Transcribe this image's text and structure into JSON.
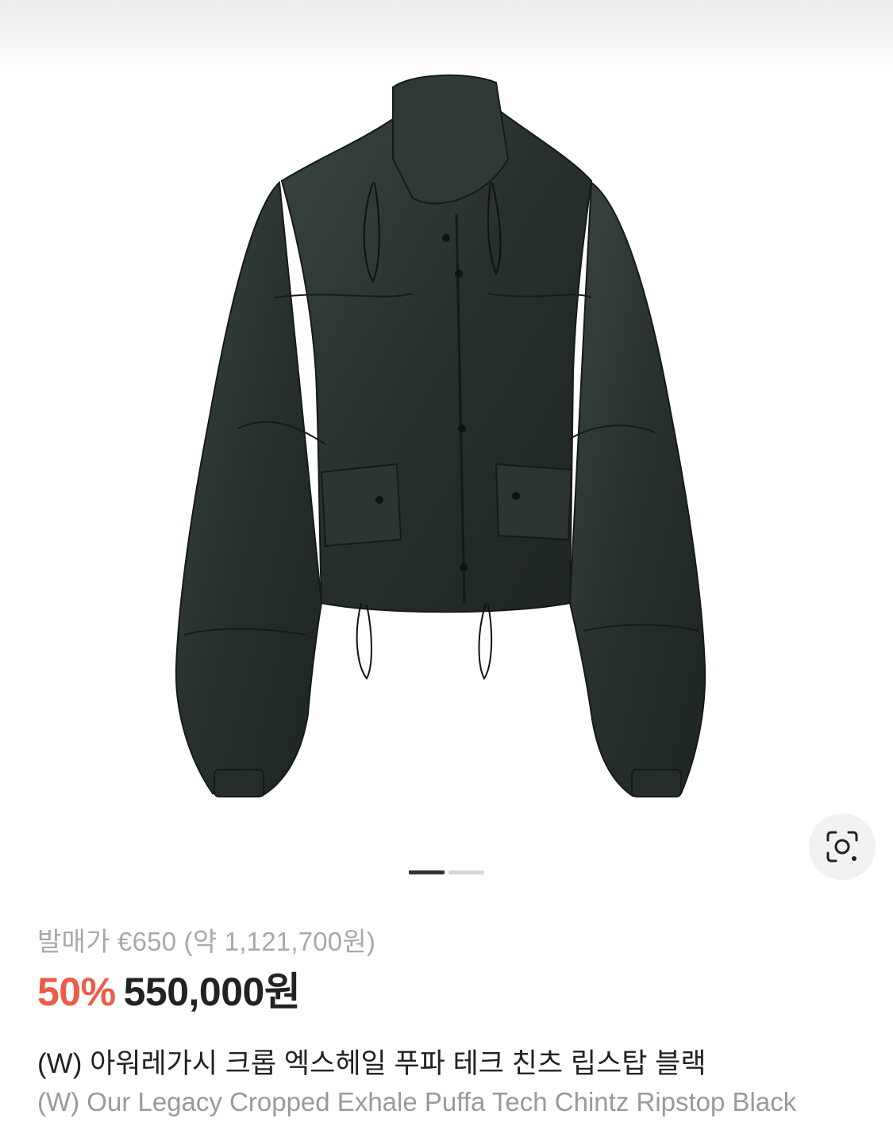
{
  "product": {
    "image_alt": "Black ripstop cropped jacket",
    "lens_icon": "visual-search-icon",
    "carousel": {
      "total": 2,
      "active": 1
    },
    "original_price_label": "발매가 €650 (약 1,121,700원)",
    "discount": "50%",
    "sale_price": "550,000원",
    "title_ko": "(W) 아워레가시 크롭 엑스헤일 푸파 테크 친츠 립스탑 블랙",
    "title_en": "(W) Our Legacy Cropped Exhale Puffa Tech Chintz Ripstop Black"
  },
  "colors": {
    "discount": "#ef5b47",
    "indicator_active": "#333333",
    "indicator_inactive": "#d6d6d6",
    "jacket": "#2a3230"
  }
}
